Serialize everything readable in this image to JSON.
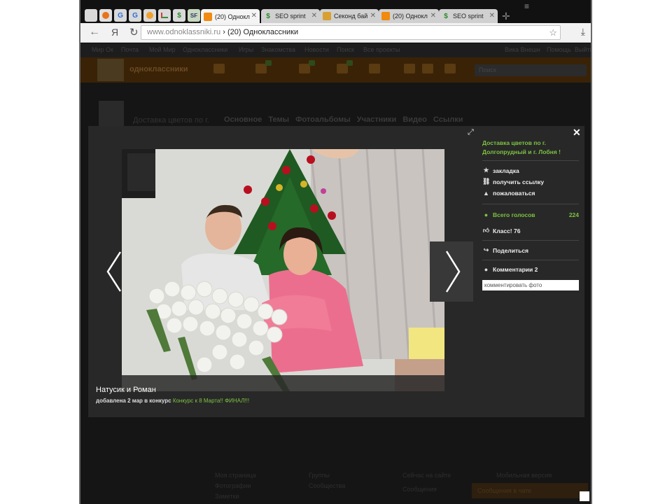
{
  "browser": {
    "pinned_tabs": [
      {
        "icon": "page-icon",
        "glyph": ""
      },
      {
        "icon": "orange-circle-icon",
        "glyph": ""
      },
      {
        "icon": "blue-g-icon",
        "glyph": "G"
      },
      {
        "icon": "blue-g2-icon",
        "glyph": "G"
      },
      {
        "icon": "orange-mail-icon",
        "glyph": ""
      },
      {
        "icon": "bar-chart-icon",
        "glyph": ""
      },
      {
        "icon": "dollar-icon",
        "glyph": "$"
      },
      {
        "icon": "sf-icon",
        "glyph": "SF"
      }
    ],
    "tabs": [
      {
        "label": "(20) Однокл",
        "active": true
      },
      {
        "label": "SEO sprint",
        "active": false
      },
      {
        "label": "Секонд бай",
        "active": false
      },
      {
        "label": "(20) Однокл",
        "active": false
      },
      {
        "label": "SEO sprint",
        "active": false
      }
    ],
    "address": {
      "domain": "www.odnoklassniki.ru",
      "separator": " › ",
      "title": "(20) Одноклассники"
    },
    "yandex_glyph": "Я"
  },
  "site": {
    "topnav": [
      "Мир Ок",
      "Почта",
      "Мой Мир",
      "Одноклассники",
      "Игры",
      "Знакомства",
      "Новости",
      "Поиск",
      "Все проекты",
      "Вика Внешн",
      "Помощь",
      "Выйти"
    ],
    "logo": "одноклассники",
    "search_placeholder": "Поиск",
    "group_title": "Доставка цветов по г.",
    "group_nav": [
      "Основное",
      "Темы",
      "Фотоальбомы",
      "Участники",
      "Видео",
      "Ссылки"
    ],
    "footer_cols": [
      [
        "Моя страница",
        "Фотографии",
        "Заметки"
      ],
      [
        "Группы",
        "Сообщества"
      ],
      [
        "Сейчас на сайте",
        "Сообщения"
      ],
      [
        "Мобильная версия"
      ]
    ],
    "chat_bar": "Сообщения в чате"
  },
  "lightbox": {
    "group_title": "Доставка цветов по г. Долгопрудный и г. Лобня !",
    "actions": {
      "bookmark": "закладка",
      "get_link": "получить ссылку",
      "report": "пожаловаться"
    },
    "votes_label": "Всего голосов",
    "votes_count": "224",
    "klass": "Класс! 76",
    "share": "Поделиться",
    "comments": "Комментарии 2",
    "comment_placeholder": "комментировать фото",
    "caption_title": "Натусик и Роман",
    "caption_prefix": "добавлена 2 мар в конкурс ",
    "caption_contest": "Конкурс к 8 Марта!! ФИНАЛ!!!"
  },
  "colors": {
    "accent_green": "#7ec242",
    "overlay_bg": "#282828"
  }
}
